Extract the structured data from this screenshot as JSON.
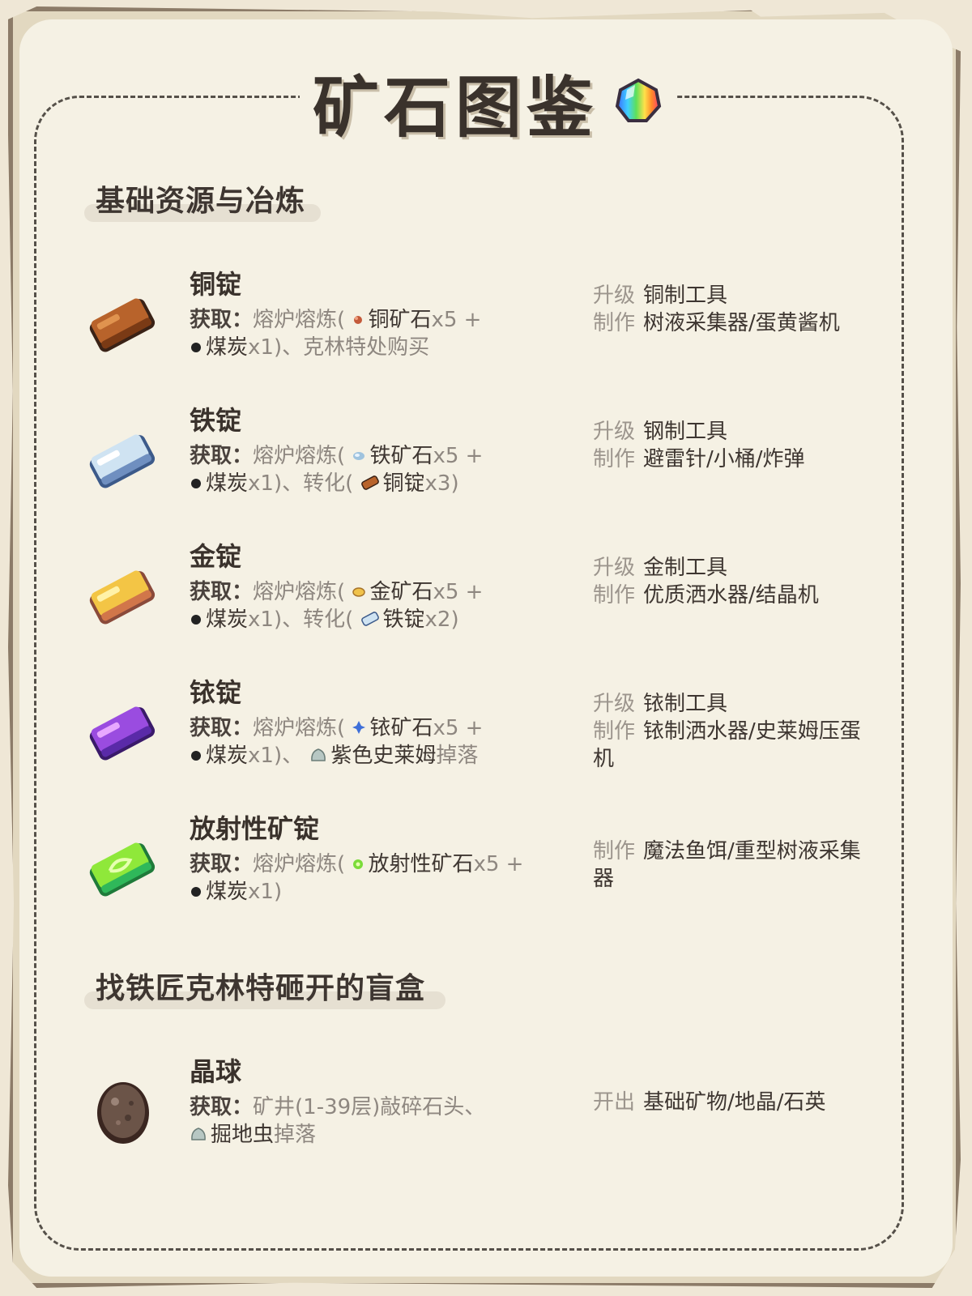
{
  "title": "矿石图鉴",
  "sections": [
    {
      "heading": "基础资源与冶炼"
    },
    {
      "heading": "找铁匠克林特砸开的盲盒"
    }
  ],
  "labels": {
    "obtain": "获取：",
    "upgrade": "升级",
    "craft": "制作",
    "open": "开出"
  },
  "items": [
    {
      "name": "铜锭",
      "obtain": {
        "prefix": "熔炉熔炼(",
        "a": "铜矿石",
        "a_qty": "x5 +",
        "b": "煤炭",
        "b_qty": "x1)、",
        "tail": "克林特处购买"
      },
      "upgrade": "铜制工具",
      "craft": "树液采集器/蛋黄酱机"
    },
    {
      "name": "铁锭",
      "obtain": {
        "prefix": "熔炉熔炼(",
        "a": "铁矿石",
        "a_qty": "x5 +",
        "b": "煤炭",
        "b_qty": "x1)、转化(",
        "c": "铜锭",
        "c_qty": "x3)"
      },
      "upgrade": "钢制工具",
      "craft": "避雷针/小桶/炸弹"
    },
    {
      "name": "金锭",
      "obtain": {
        "prefix": "熔炉熔炼(",
        "a": "金矿石",
        "a_qty": "x5 +",
        "b": "煤炭",
        "b_qty": "x1)、转化(",
        "c": "铁锭",
        "c_qty": "x2)"
      },
      "upgrade": "金制工具",
      "craft": "优质洒水器/结晶机"
    },
    {
      "name": "铱锭",
      "obtain": {
        "prefix": "熔炉熔炼(",
        "a": "铱矿石",
        "a_qty": "x5 +",
        "b": "煤炭",
        "b_qty": "x1)、",
        "c": "紫色史莱姆",
        "c_tail": "掉落"
      },
      "upgrade": "铱制工具",
      "craft": "铱制洒水器/史莱姆压蛋机"
    },
    {
      "name": "放射性矿锭",
      "obtain": {
        "prefix": "熔炉熔炼(",
        "a": "放射性矿石",
        "a_qty": "x5 +",
        "b": "煤炭",
        "b_qty": "x1)"
      },
      "craft": "魔法鱼饵/重型树液采集器"
    },
    {
      "name": "晶球",
      "obtain": {
        "prefix": "矿井(1-39层)敲碎石头、",
        "b": "掘地虫",
        "b_tail": "掉落"
      },
      "open": "基础矿物/地晶/石英"
    }
  ],
  "colors": {
    "copper": "#b8632b",
    "iron": "#cfe3f2",
    "gold": "#f3c545",
    "iridium": "#9a4ce0",
    "radioactive": "#8fe83a",
    "geode": "#6b5448"
  }
}
